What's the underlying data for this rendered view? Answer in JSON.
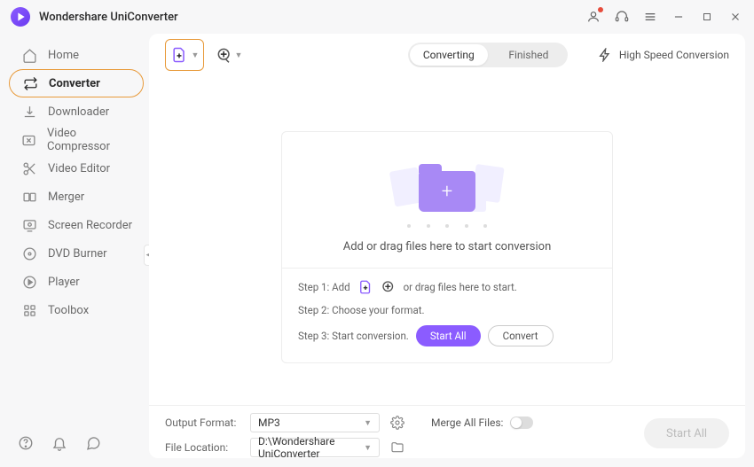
{
  "app": {
    "title": "Wondershare UniConverter"
  },
  "sidebar": {
    "items": [
      {
        "label": "Home",
        "icon": "home-icon"
      },
      {
        "label": "Converter",
        "icon": "convert-icon",
        "selected": true
      },
      {
        "label": "Downloader",
        "icon": "download-icon"
      },
      {
        "label": "Video Compressor",
        "icon": "compress-icon"
      },
      {
        "label": "Video Editor",
        "icon": "scissors-icon"
      },
      {
        "label": "Merger",
        "icon": "merge-icon"
      },
      {
        "label": "Screen Recorder",
        "icon": "record-icon"
      },
      {
        "label": "DVD Burner",
        "icon": "disc-icon"
      },
      {
        "label": "Player",
        "icon": "play-icon"
      },
      {
        "label": "Toolbox",
        "icon": "grid-icon"
      }
    ]
  },
  "toolbar": {
    "tabs": {
      "converting": "Converting",
      "finished": "Finished"
    },
    "high_speed": "High Speed Conversion"
  },
  "dropzone": {
    "text": "Add or drag files here to start conversion",
    "step1_prefix": "Step 1: Add",
    "step1_suffix": "or drag files here to start.",
    "step2": "Step 2: Choose your format.",
    "step3": "Step 3: Start conversion.",
    "start_all": "Start All",
    "convert": "Convert"
  },
  "footer": {
    "output_format_label": "Output Format:",
    "output_format_value": "MP3",
    "file_location_label": "File Location:",
    "file_location_value": "D:\\Wondershare UniConverter",
    "merge_label": "Merge All Files:",
    "start_all": "Start All"
  }
}
